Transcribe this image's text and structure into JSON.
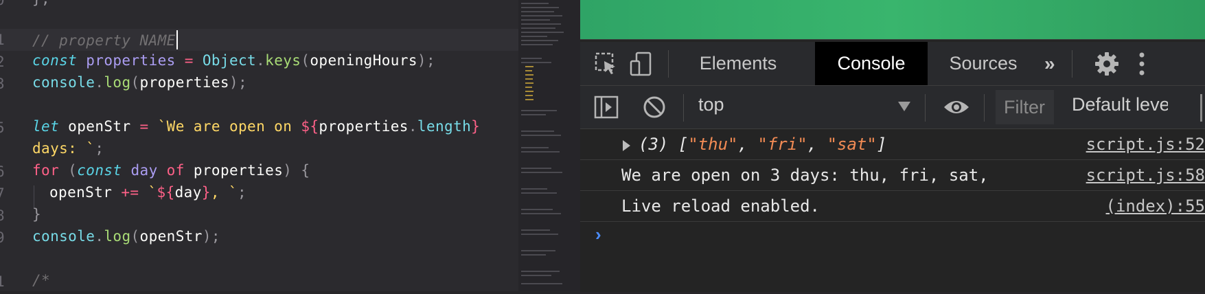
{
  "editor": {
    "line_numbers": [
      "0",
      "1",
      "2",
      "3",
      "4",
      "5",
      "6",
      "7",
      "8",
      "9",
      "0",
      "1"
    ],
    "lines": {
      "l0": "};",
      "l1": "// property NAME",
      "l2a": "const",
      "l2b": " properties",
      "l2c": " = ",
      "l2d": "Object",
      "l2e": ".",
      "l2f": "keys",
      "l2g": "(",
      "l2h": "openingHours",
      "l2i": ");",
      "l3a": "console",
      "l3b": ".",
      "l3c": "log",
      "l3d": "(",
      "l3e": "properties",
      "l3f": ");",
      "l5a": "let",
      "l5b": " openStr ",
      "l5c": "= ",
      "l5d": "`We are open on ",
      "l5e": "${",
      "l5f": "properties",
      "l5g": ".",
      "l5h": "length",
      "l5i": "}",
      "l6a": "days: ",
      "l6b": "`",
      "l6c": ";",
      "l7a": "for",
      "l7b": " (",
      "l7c": "const",
      "l7d": " day",
      "l7e": " of",
      "l7f": " properties",
      "l7g": ") {",
      "l8a": "openStr ",
      "l8b": "+=",
      "l8c": " `",
      "l8d": "${",
      "l8e": "day",
      "l8f": "}",
      "l8g": ", `",
      "l8h": ";",
      "l9": "}",
      "l10a": "console",
      "l10b": ".",
      "l10c": "log",
      "l10d": "(",
      "l10e": "openStr",
      "l10f": ");",
      "l12": "/*"
    }
  },
  "devtools": {
    "tabs": [
      "Elements",
      "Console",
      "Sources"
    ],
    "active_tab": "Console",
    "more_tabs": "»",
    "context": "top",
    "filter_placeholder": "Filter",
    "levels": "Default leve",
    "icons": [
      "inspect-element-icon",
      "device-toolbar-icon",
      "settings-gear-icon",
      "kebab-menu-icon",
      "sidebar-toggle-icon",
      "clear-console-icon",
      "eye-icon"
    ]
  },
  "console": {
    "messages": [
      {
        "count": "(3) ",
        "open": "[",
        "items": [
          "\"thu\"",
          "\"fri\"",
          "\"sat\""
        ],
        "sep": ", ",
        "close": "]",
        "source": "script.js:52"
      },
      {
        "text": "We are open on 3 days: thu, fri, sat,",
        "source": "script.js:58"
      },
      {
        "text": "Live reload enabled.",
        "source": "(index):55"
      }
    ],
    "prompt": "›"
  }
}
